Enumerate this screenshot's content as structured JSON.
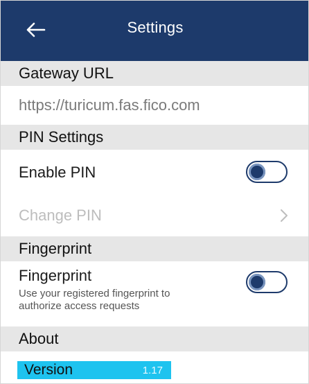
{
  "header": {
    "title": "Settings",
    "back_icon": "arrow-left-icon"
  },
  "sections": {
    "gateway": {
      "title": "Gateway URL",
      "url": "https://turicum.fas.fico.com"
    },
    "pin": {
      "title": "PIN Settings",
      "enable_label": "Enable PIN",
      "enable_state": "off",
      "change_label": "Change PIN",
      "change_icon": "chevron-right-icon"
    },
    "fingerprint": {
      "title": "Fingerprint",
      "label": "Fingerprint",
      "description": "Use your registered fingerprint to authorize access requests",
      "state": "off"
    },
    "about": {
      "title": "About",
      "version_label": "Version",
      "version_value": "1.17"
    }
  },
  "colors": {
    "header_bg": "#1d3a6b",
    "section_bg": "#e6e6e6",
    "highlight": "#1ec3ef"
  }
}
